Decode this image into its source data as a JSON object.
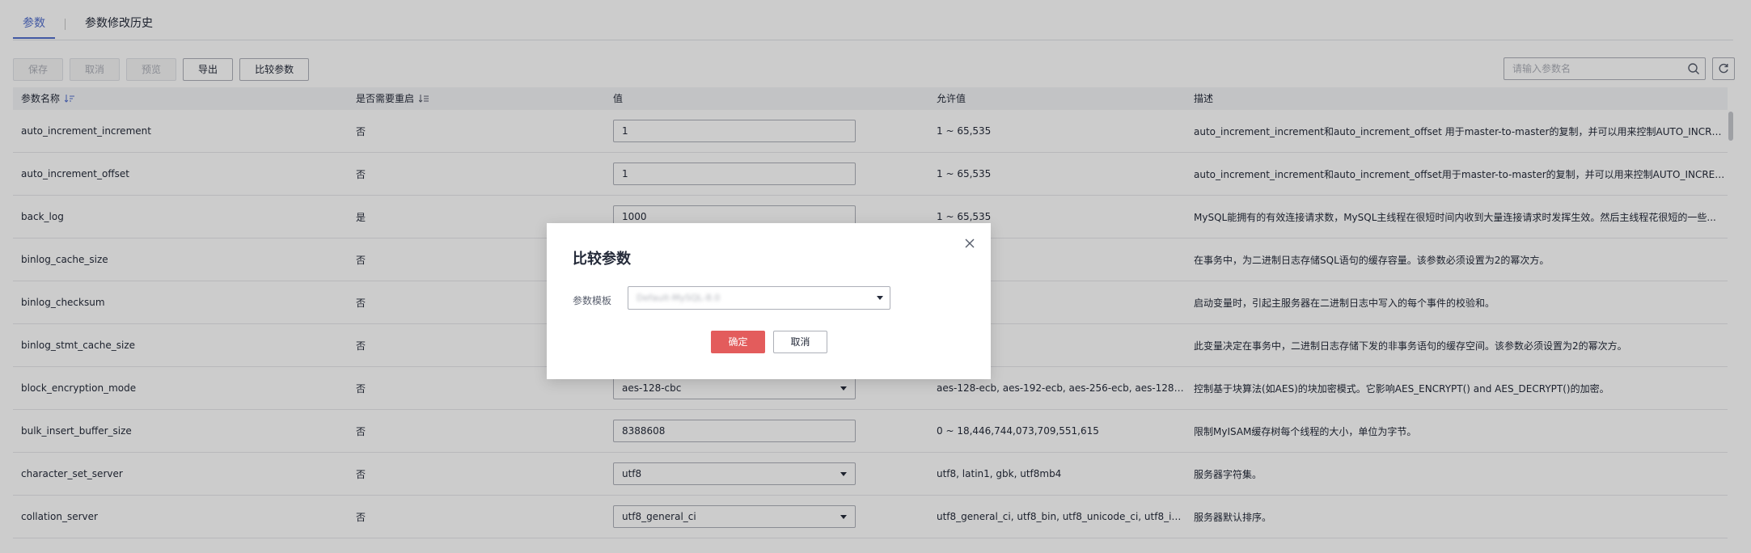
{
  "tabs": [
    {
      "label": "参数"
    },
    {
      "label": "参数修改历史"
    }
  ],
  "toolbar": {
    "save": "保存",
    "cancel": "取消",
    "preview": "预览",
    "export": "导出",
    "compare": "比较参数"
  },
  "search": {
    "placeholder": "请输入参数名"
  },
  "table": {
    "headers": [
      "参数名称",
      "是否需要重启",
      "值",
      "允许值",
      "描述"
    ],
    "rows": [
      {
        "name": "auto_increment_increment",
        "restart": "否",
        "value": "1",
        "select": false,
        "allowed": "1 ~ 65,535",
        "desc": "auto_increment_increment和auto_increment_offset 用于master-to-master的复制，并可以用来控制AUTO_INCREMENT..."
      },
      {
        "name": "auto_increment_offset",
        "restart": "否",
        "value": "1",
        "select": false,
        "allowed": "1 ~ 65,535",
        "desc": "auto_increment_increment和auto_increment_offset用于master-to-master的复制，并可以用来控制AUTO_INCREMENT..."
      },
      {
        "name": "back_log",
        "restart": "是",
        "value": "1000",
        "select": false,
        "allowed": "1 ~ 65,535",
        "desc": "MySQL能拥有的有效连接请求数，MySQL主线程在很短时间内收到大量连接请求时发挥生效。然后主线程花很短的一些..."
      },
      {
        "name": "binlog_cache_size",
        "restart": "否",
        "value": "",
        "select": false,
        "allowed": "...77,216",
        "desc": "在事务中，为二进制日志存储SQL语句的缓存容量。该参数必须设置为2的幂次方。"
      },
      {
        "name": "binlog_checksum",
        "restart": "否",
        "value": "",
        "select": false,
        "allowed": "...32",
        "desc": "启动变量时，引起主服务器在二进制日志中写入的每个事件的校验和。"
      },
      {
        "name": "binlog_stmt_cache_size",
        "restart": "否",
        "value": "",
        "select": false,
        "allowed": "...77,216",
        "desc": "此变量决定在事务中，二进制日志存储下发的非事务语句的缓存空间。该参数必须设置为2的幂次方。"
      },
      {
        "name": "block_encryption_mode",
        "restart": "否",
        "value": "aes-128-cbc",
        "select": true,
        "allowed": "aes-128-ecb, aes-192-ecb, aes-256-ecb, aes-128-cbc, ...",
        "desc": "控制基于块算法(如AES)的块加密模式。它影响AES_ENCRYPT() and AES_DECRYPT()的加密。"
      },
      {
        "name": "bulk_insert_buffer_size",
        "restart": "否",
        "value": "8388608",
        "select": false,
        "allowed": "0 ~ 18,446,744,073,709,551,615",
        "desc": "限制MyISAM缓存树每个线程的大小，单位为字节。"
      },
      {
        "name": "character_set_server",
        "restart": "否",
        "value": "utf8",
        "select": true,
        "allowed": "utf8, latin1, gbk, utf8mb4",
        "desc": "服务器字符集。"
      },
      {
        "name": "collation_server",
        "restart": "否",
        "value": "utf8_general_ci",
        "select": true,
        "allowed": "utf8_general_ci, utf8_bin, utf8_unicode_ci, utf8_icelan...",
        "desc": "服务器默认排序。"
      }
    ]
  },
  "dialog": {
    "title": "比较参数",
    "label": "参数模板",
    "selected": "Default-MySQL-8.0",
    "ok": "确定",
    "cancel": "取消"
  },
  "colors": {
    "accent": "#526ecc",
    "danger": "#e35c5c"
  }
}
